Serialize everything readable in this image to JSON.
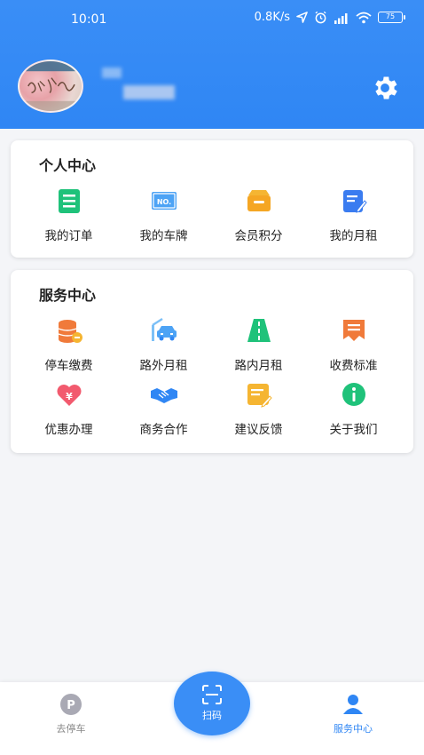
{
  "status_bar": {
    "time": "10:01",
    "speed": "0.8K/s",
    "battery": "75"
  },
  "header": {
    "avatar_icon": "user-avatar",
    "settings_icon": "gear-icon"
  },
  "personal_center": {
    "title": "个人中心",
    "items": [
      {
        "label": "我的订单",
        "icon": "order-icon",
        "color": "#1fc27a"
      },
      {
        "label": "我的车牌",
        "icon": "license-plate-icon",
        "color": "#4da3f5"
      },
      {
        "label": "会员积分",
        "icon": "wallet-icon",
        "color": "#f5b532"
      },
      {
        "label": "我的月租",
        "icon": "edit-doc-icon",
        "color": "#3a7cf0"
      }
    ]
  },
  "service_center": {
    "title": "服务中心",
    "items": [
      {
        "label": "停车缴费",
        "icon": "coin-stack-icon",
        "color": "#f07a3a"
      },
      {
        "label": "路外月租",
        "icon": "parking-car-icon",
        "color": "#4da3f5"
      },
      {
        "label": "路内月租",
        "icon": "road-icon",
        "color": "#1fc27a"
      },
      {
        "label": "收费标准",
        "icon": "pricing-doc-icon",
        "color": "#f07a3a"
      },
      {
        "label": "优惠办理",
        "icon": "heart-yuan-icon",
        "color": "#f25a6e"
      },
      {
        "label": "商务合作",
        "icon": "handshake-icon",
        "color": "#2f86f4"
      },
      {
        "label": "建议反馈",
        "icon": "feedback-icon",
        "color": "#f5b532"
      },
      {
        "label": "关于我们",
        "icon": "info-icon",
        "color": "#1fc27a"
      }
    ]
  },
  "bottom_nav": {
    "park_label": "去停车",
    "scan_label": "扫码",
    "service_label": "服务中心",
    "active_color": "#2f86f4",
    "inactive_color": "#888888"
  }
}
